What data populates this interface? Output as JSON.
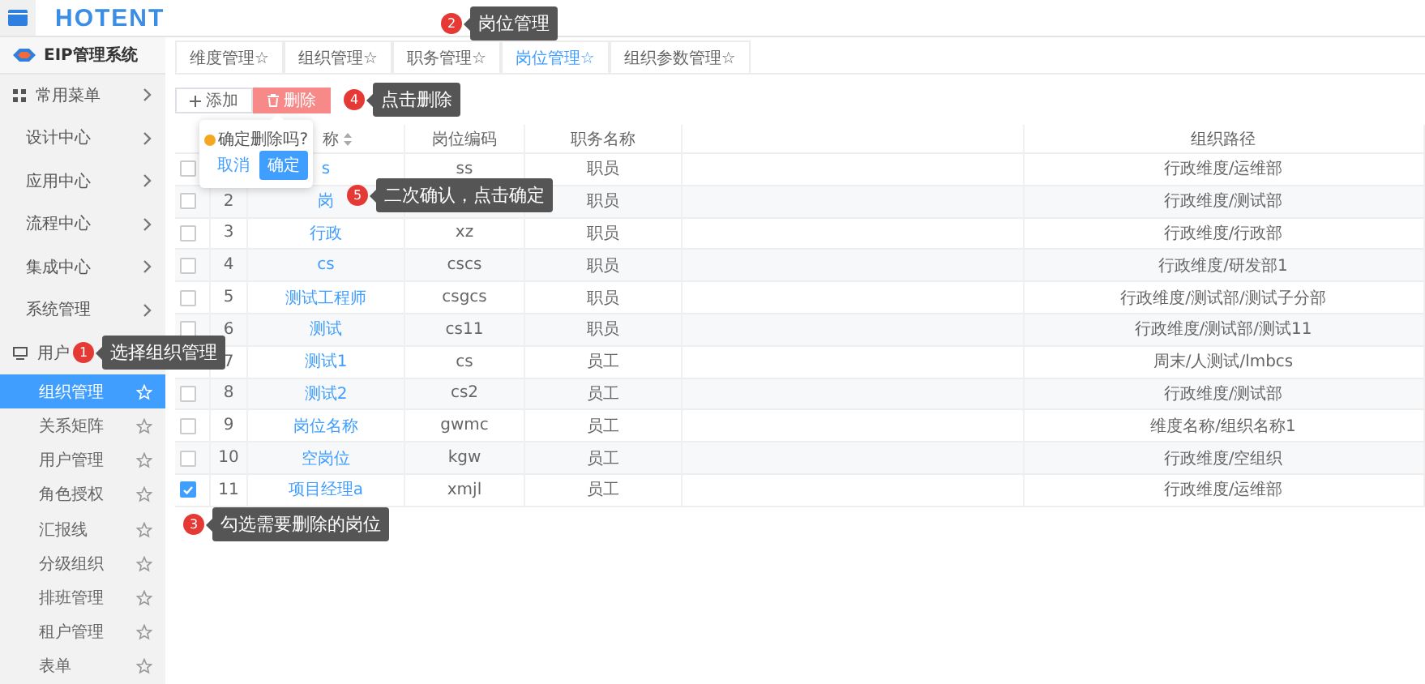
{
  "app": {
    "logo": "HOTENT",
    "system_name": "EIP管理系统"
  },
  "sidebar": {
    "favorites": {
      "label": "常用菜单"
    },
    "menus": [
      "设计中心",
      "应用中心",
      "流程中心",
      "集成中心",
      "系统管理"
    ],
    "user_menu": {
      "label": "用户",
      "children": [
        {
          "label": "组织管理",
          "selected": true
        },
        {
          "label": "关系矩阵",
          "selected": false
        },
        {
          "label": "用户管理",
          "selected": false
        },
        {
          "label": "角色授权",
          "selected": false
        },
        {
          "label": "汇报线",
          "selected": false
        },
        {
          "label": "分级组织",
          "selected": false
        },
        {
          "label": "排班管理",
          "selected": false
        },
        {
          "label": "租户管理",
          "selected": false
        },
        {
          "label": "表单",
          "selected": false
        }
      ]
    }
  },
  "tabs": [
    {
      "label": "维度管理☆",
      "selected": false
    },
    {
      "label": "组织管理☆",
      "selected": false
    },
    {
      "label": "职务管理☆",
      "selected": false
    },
    {
      "label": "岗位管理☆",
      "selected": true
    },
    {
      "label": "组织参数管理☆",
      "selected": false
    }
  ],
  "toolbar": [
    {
      "label": "添加",
      "kind": "add"
    },
    {
      "label": "删除",
      "kind": "delete"
    }
  ],
  "table": {
    "columns": [
      "称",
      "岗位编码",
      "职务名称",
      "组织路径"
    ],
    "rows": [
      {
        "name": "s",
        "code": "ss",
        "duty": "职员",
        "path": "行政维度/运维部",
        "checked": false
      },
      {
        "index": "2",
        "name": "岗",
        "duty": "职员",
        "path": "行政维度/测试部",
        "checked": false
      },
      {
        "index": "3",
        "name": "行政",
        "code": "xz",
        "duty": "职员",
        "path": "行政维度/行政部",
        "checked": false
      },
      {
        "index": "4",
        "name": "cs",
        "code": "cscs",
        "duty": "职员",
        "path": "行政维度/研发部1",
        "checked": false
      },
      {
        "index": "5",
        "name": "测试工程师",
        "code": "csgcs",
        "duty": "职员",
        "path": "行政维度/测试部/测试子分部",
        "checked": false
      },
      {
        "index": "6",
        "name": "测试",
        "code": "cs11",
        "duty": "职员",
        "path": "行政维度/测试部/测试11",
        "checked": false
      },
      {
        "index": "7",
        "name": "测试1",
        "code": "cs",
        "duty": "员工",
        "path": "周末/人测试/lmbcs"
      },
      {
        "index": "8",
        "name": "测试2",
        "code": "cs2",
        "duty": "员工",
        "path": "行政维度/测试部",
        "checked": false
      },
      {
        "index": "9",
        "name": "岗位名称",
        "code": "gwmc",
        "duty": "员工",
        "path": "维度名称/组织名称1",
        "checked": false
      },
      {
        "index": "10",
        "name": "空岗位",
        "code": "kgw",
        "duty": "员工",
        "path": "行政维度/空组织",
        "checked": false
      },
      {
        "index": "11",
        "name": "项目经理a",
        "code": "xmjl",
        "duty": "员工",
        "path": "行政维度/运维部",
        "checked": true
      }
    ]
  },
  "confirm_popup": {
    "message": "确定删除吗?",
    "cancel": "取消",
    "confirm": "确定"
  },
  "callouts": [
    {
      "number": "2",
      "text": "岗位管理"
    },
    {
      "number": "4",
      "text": "点击删除"
    },
    {
      "number": "5",
      "text": "二次确认，点击确定"
    },
    {
      "number": "1",
      "text": "选择组织管理"
    },
    {
      "number": "3",
      "text": "勾选需要删除的岗位"
    }
  ]
}
